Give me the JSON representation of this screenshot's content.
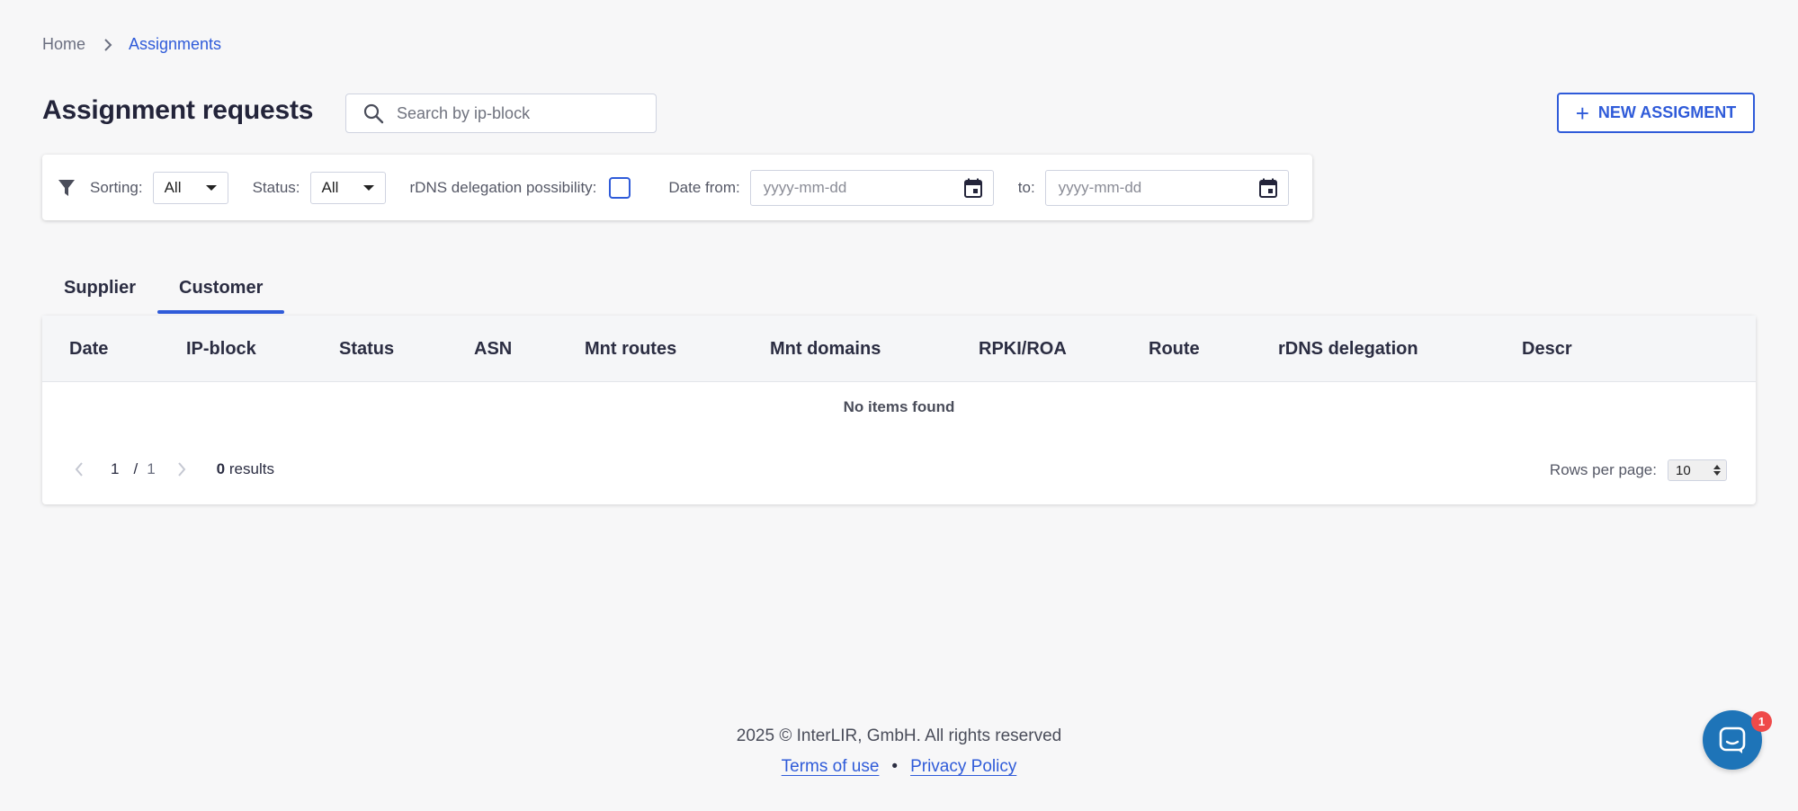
{
  "breadcrumb": {
    "home": "Home",
    "current": "Assignments"
  },
  "page": {
    "title": "Assignment requests"
  },
  "search": {
    "placeholder": "Search by ip-block"
  },
  "new_button": {
    "label": "NEW ASSIGMENT"
  },
  "filters": {
    "sorting_label": "Sorting:",
    "sorting_value": "All",
    "status_label": "Status:",
    "status_value": "All",
    "rdns_label": "rDNS delegation possibility:",
    "rdns_checked": false,
    "date_from_label": "Date from:",
    "date_from_placeholder": "yyyy-mm-dd",
    "date_to_label": "to:",
    "date_to_placeholder": "yyyy-mm-dd"
  },
  "tabs": [
    {
      "label": "Supplier",
      "active": false
    },
    {
      "label": "Customer",
      "active": true
    }
  ],
  "table": {
    "columns": [
      "Date",
      "IP-block",
      "Status",
      "ASN",
      "Mnt routes",
      "Mnt domains",
      "RPKI/ROA",
      "Route",
      "rDNS delegation",
      "Descr"
    ],
    "empty_text": "No items found"
  },
  "pagination": {
    "current_page": "1",
    "separator": "/",
    "total_pages": "1",
    "results_count": "0",
    "results_label": "results",
    "rows_per_page_label": "Rows per page:",
    "rows_per_page_value": "10"
  },
  "footer": {
    "copyright": "2025 © InterLIR, GmbH. All rights reserved",
    "terms": "Terms of use",
    "separator": "•",
    "privacy": "Privacy Policy"
  },
  "chat": {
    "badge_count": "1"
  },
  "colors": {
    "accent": "#2f5bd9",
    "chat": "#1e74b8",
    "badge": "#ef4a4a",
    "background": "#f7f7f8"
  }
}
